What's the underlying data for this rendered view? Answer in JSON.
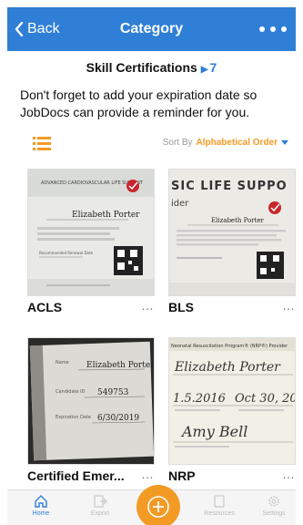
{
  "header": {
    "back_label": "Back",
    "title": "Category",
    "more_icon": "more-dots-icon",
    "color": "#2f7fd6"
  },
  "section": {
    "title": "Skill Certifications",
    "count": "7"
  },
  "reminder_text": "Don't forget to add your expiration date so JobDocs can provide a reminder for you.",
  "toolbar": {
    "list_icon": "list-view-icon",
    "sort_label": "Sort By",
    "sort_value": "Alphabetical Order",
    "accent": "#f39a24"
  },
  "cards": [
    {
      "name": "ACLS",
      "more": "…",
      "thumb": {
        "header": "ADVANCED CARDIOVASCULAR LIFE SUPPORT",
        "holder": "Elizabeth Porter",
        "issue_label": "Issue Date",
        "renew_label": "Recommended Renewal Date"
      }
    },
    {
      "name": "BLS",
      "more": "…",
      "thumb": {
        "header": "SIC LIFE SUPPO",
        "sub": "ider",
        "holder": "Elizabeth Porter"
      }
    },
    {
      "name": "Certified Emer...",
      "more": "…",
      "thumb": {
        "name_label": "Name",
        "holder": "Elizabeth Porter",
        "cand_label": "Candidate ID",
        "cand_id": "549753",
        "exp_label": "Expiration Date",
        "exp_date": "6/30/2019"
      }
    },
    {
      "name": "NRP",
      "more": "…",
      "thumb": {
        "header": "Neonatal Resuscitation Program® (NRP®) Provider",
        "holder": "Elizabeth Porter",
        "date_1": "1.5.2016",
        "date_2": "Oct 30, 20",
        "signature": "Amy Bell"
      }
    }
  ],
  "bottom_nav": {
    "items": [
      {
        "label": "Home",
        "icon": "home-icon",
        "active": true
      },
      {
        "label": "Export",
        "icon": "export-icon",
        "active": false
      },
      {
        "label": "Resources",
        "icon": "resources-icon",
        "active": false
      },
      {
        "label": "Settings",
        "icon": "settings-gear-icon",
        "active": false
      }
    ],
    "add_icon": "add-circle-icon"
  }
}
